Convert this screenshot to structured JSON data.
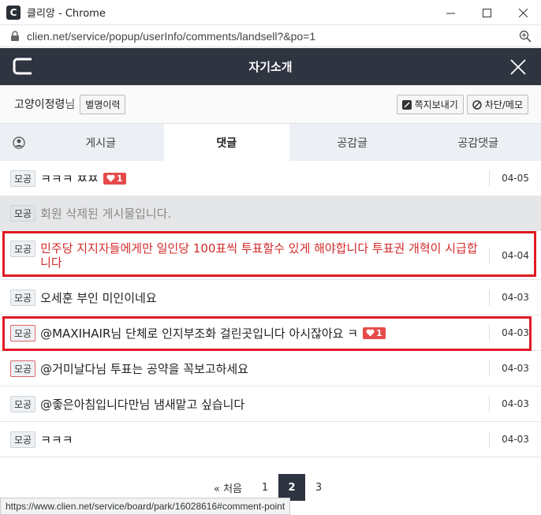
{
  "window": {
    "title": "클리앙 - Chrome",
    "app_letter": "C",
    "url": "clien.net/service/popup/userInfo/comments/landsell?&po=1"
  },
  "header": {
    "title": "자기소개"
  },
  "user": {
    "nick": "고양이정령",
    "suffix": "님",
    "history_label": "별명이력",
    "message_label": "쪽지보내기",
    "block_label": "차단/메모"
  },
  "tabs": [
    "게시글",
    "댓글",
    "공감글",
    "공감댓글"
  ],
  "rows": [
    {
      "tag": "모공",
      "text": "ㅋㅋㅋ ㅉㅉ",
      "likes": "1",
      "date": "04-05"
    },
    {
      "tag": "모공",
      "text": "회원 삭제된 게시물입니다."
    },
    {
      "tag": "모공",
      "text": "민주당 지지자들에게만 일인당 100표씩 투표할수 있게 해야합니다 투표권 개혁이 시급합니다",
      "date": "04-04"
    },
    {
      "tag": "모공",
      "text": "오세훈 부인 미인이네요",
      "date": "04-03"
    },
    {
      "tag": "모공",
      "text": "@MAXIHAIR님 단체로 인지부조화 걸린곳입니다 아시잖아요 ㅋ",
      "likes": "1",
      "date": "04-03"
    },
    {
      "tag": "모공",
      "text": "@거미날다님 투표는 공약을 꼭보고하세요",
      "date": "04-03"
    },
    {
      "tag": "모공",
      "text": "@좋은아침입니다만님 냄새맡고 싶습니다",
      "date": "04-03"
    },
    {
      "tag": "모공",
      "text": "ㅋㅋㅋ",
      "date": "04-03"
    }
  ],
  "pagination": {
    "first": "« 처음",
    "pages": [
      "1",
      "2",
      "3"
    ],
    "current": "2"
  },
  "status_url": "https://www.clien.net/service/board/park/16028616#comment-point",
  "colors": {
    "header_bg": "#2e3440",
    "highlight": "#e01b24",
    "heart": "#e64a4a",
    "red_text": "#d32a2a"
  },
  "icons": [
    "lock-icon",
    "zoom-icon",
    "clien-logo-icon",
    "close-icon",
    "avatar-icon",
    "message-icon",
    "block-icon",
    "heart-icon"
  ]
}
